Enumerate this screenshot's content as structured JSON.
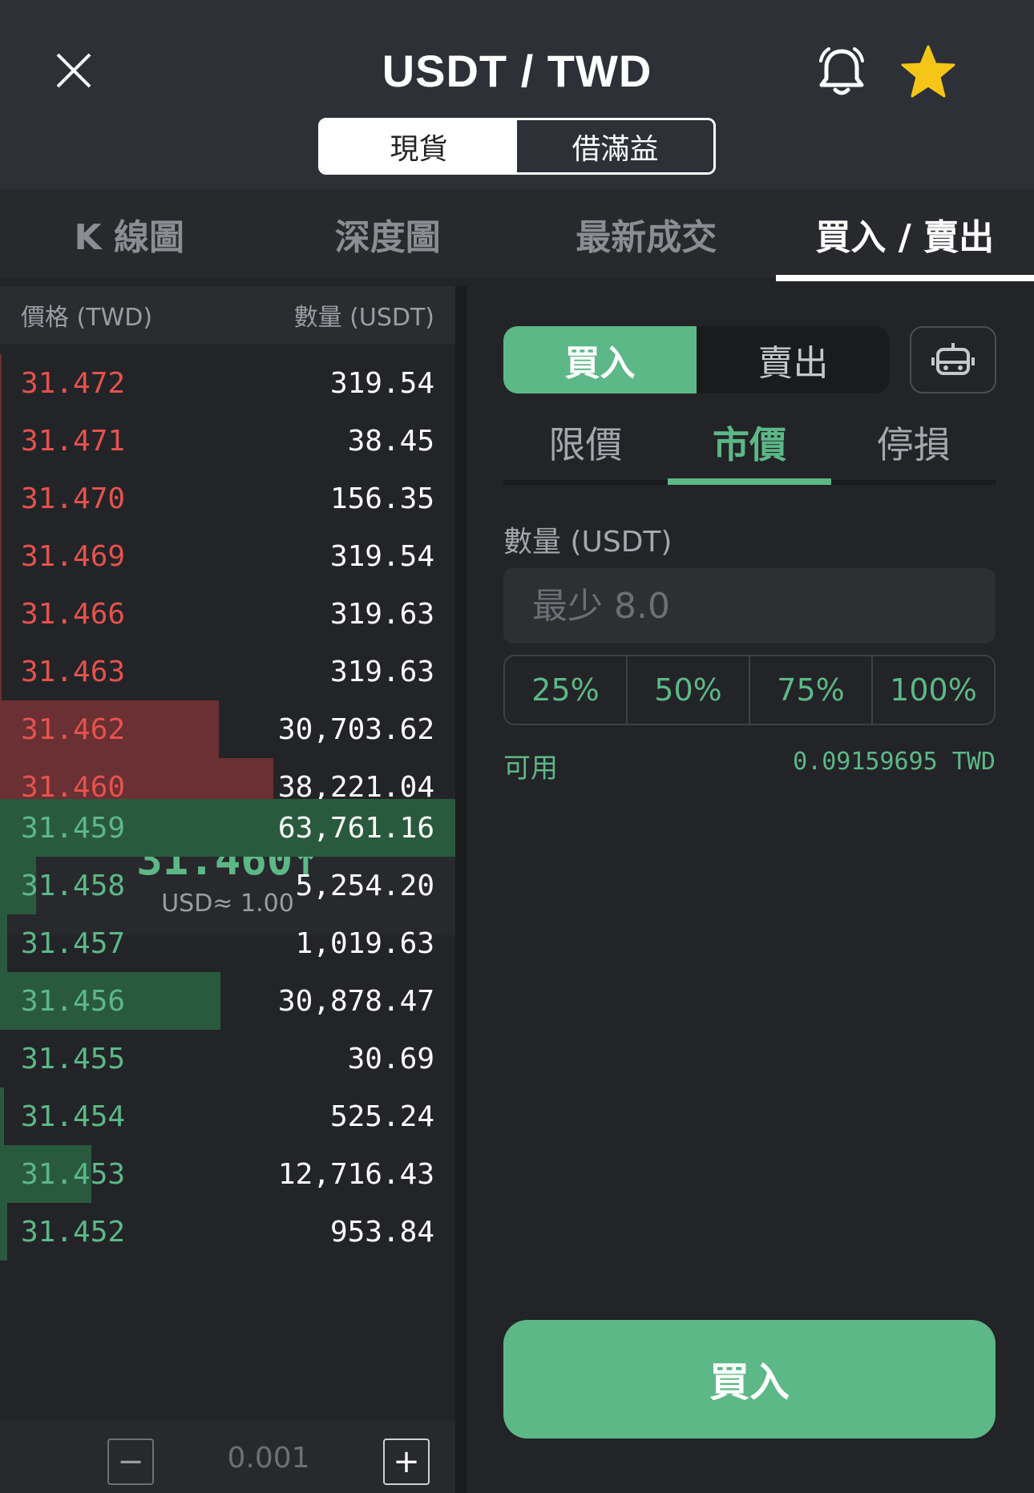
{
  "header": {
    "title": "USDT / TWD",
    "segment": {
      "spot": "現貨",
      "margin": "借滿益"
    },
    "accent_star": "#f5c518"
  },
  "tabs": [
    "K 線圖",
    "深度圖",
    "最新成交",
    "買入 / 賣出"
  ],
  "book": {
    "price_header": "價格 (TWD)",
    "qty_header": "數量 (USDT)",
    "asks": [
      {
        "price": "31.472",
        "qty": "319.54",
        "depth": 0.004
      },
      {
        "price": "31.471",
        "qty": "38.45",
        "depth": 0.004
      },
      {
        "price": "31.470",
        "qty": "156.35",
        "depth": 0.004
      },
      {
        "price": "31.469",
        "qty": "319.54",
        "depth": 0.004
      },
      {
        "price": "31.466",
        "qty": "319.63",
        "depth": 0.004
      },
      {
        "price": "31.463",
        "qty": "319.63",
        "depth": 0.004
      },
      {
        "price": "31.462",
        "qty": "30,703.62",
        "depth": 0.48
      },
      {
        "price": "31.460",
        "qty": "38,221.04",
        "depth": 0.6
      }
    ],
    "last_price": "31.460↑",
    "usd_ref": "USD≈ 1.00",
    "bids": [
      {
        "price": "31.459",
        "qty": "63,761.16",
        "depth": 1.0
      },
      {
        "price": "31.458",
        "qty": "5,254.20",
        "depth": 0.08
      },
      {
        "price": "31.457",
        "qty": "1,019.63",
        "depth": 0.016
      },
      {
        "price": "31.456",
        "qty": "30,878.47",
        "depth": 0.485
      },
      {
        "price": "31.455",
        "qty": "30.69",
        "depth": 0.0
      },
      {
        "price": "31.454",
        "qty": "525.24",
        "depth": 0.008
      },
      {
        "price": "31.453",
        "qty": "12,716.43",
        "depth": 0.2
      },
      {
        "price": "31.452",
        "qty": "953.84",
        "depth": 0.015
      }
    ],
    "step": "0.001",
    "minus": "−",
    "plus": "+"
  },
  "trade": {
    "buy": "買入",
    "sell": "賣出",
    "order_types": [
      "限價",
      "市價",
      "停損"
    ],
    "qty_label": "數量 (USDT)",
    "qty_placeholder": "最少 8.0",
    "percents": [
      "25%",
      "50%",
      "75%",
      "100%"
    ],
    "avail_label": "可用",
    "avail_value": "0.09159695 TWD",
    "submit": "買入",
    "accent": "#5cb887"
  }
}
